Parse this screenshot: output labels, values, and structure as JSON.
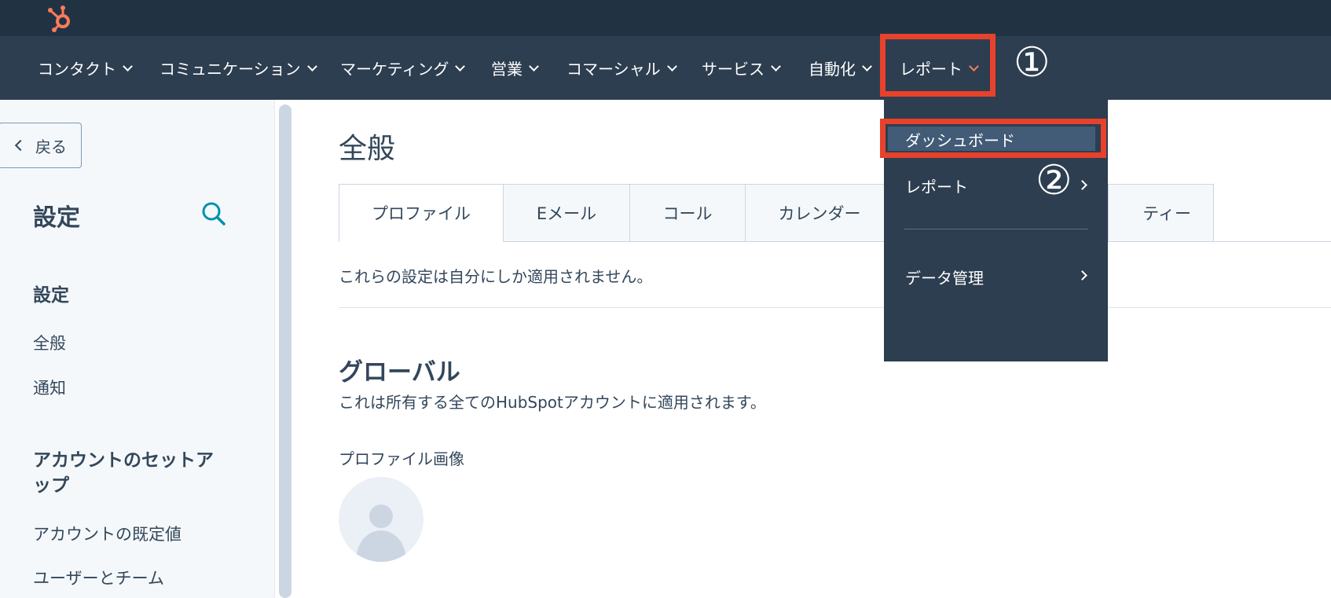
{
  "nav": {
    "items": [
      {
        "label": "コンタクト"
      },
      {
        "label": "コミュニケーション"
      },
      {
        "label": "マーケティング"
      },
      {
        "label": "営業"
      },
      {
        "label": "コマーシャル"
      },
      {
        "label": "サービス"
      },
      {
        "label": "自動化"
      },
      {
        "label": "レポート"
      }
    ]
  },
  "annotations": {
    "step1": "①",
    "step2": "②"
  },
  "dropdown": {
    "items": [
      {
        "label": "ダッシュボード"
      },
      {
        "label": "レポート"
      },
      {
        "label": "データ管理"
      }
    ]
  },
  "sidebar": {
    "back_label": "戻る",
    "title": "設定",
    "section1_heading": "設定",
    "section1_links": [
      "全般",
      "通知"
    ],
    "section2_heading_line1": "アカウントのセットア",
    "section2_heading_line2": "ップ",
    "section2_links": [
      "アカウントの既定値",
      "ユーザーとチーム"
    ]
  },
  "main": {
    "title": "全般",
    "tabs": [
      {
        "label": "プロファイル"
      },
      {
        "label": "Eメール"
      },
      {
        "label": "コール"
      },
      {
        "label": "カレンダー"
      },
      {
        "label": "ティー"
      }
    ],
    "description": "これらの設定は自分にしか適用されません。",
    "section_heading": "グローバル",
    "section_description": "これは所有する全てのHubSpotアカウントに適用されます。",
    "profile_image_label": "プロファイル画像"
  },
  "colors": {
    "topbar": "#213343",
    "navbar": "#2d3e50",
    "accent": "#ff7a59",
    "annotation": "#e8412c",
    "text": "#33475b"
  }
}
